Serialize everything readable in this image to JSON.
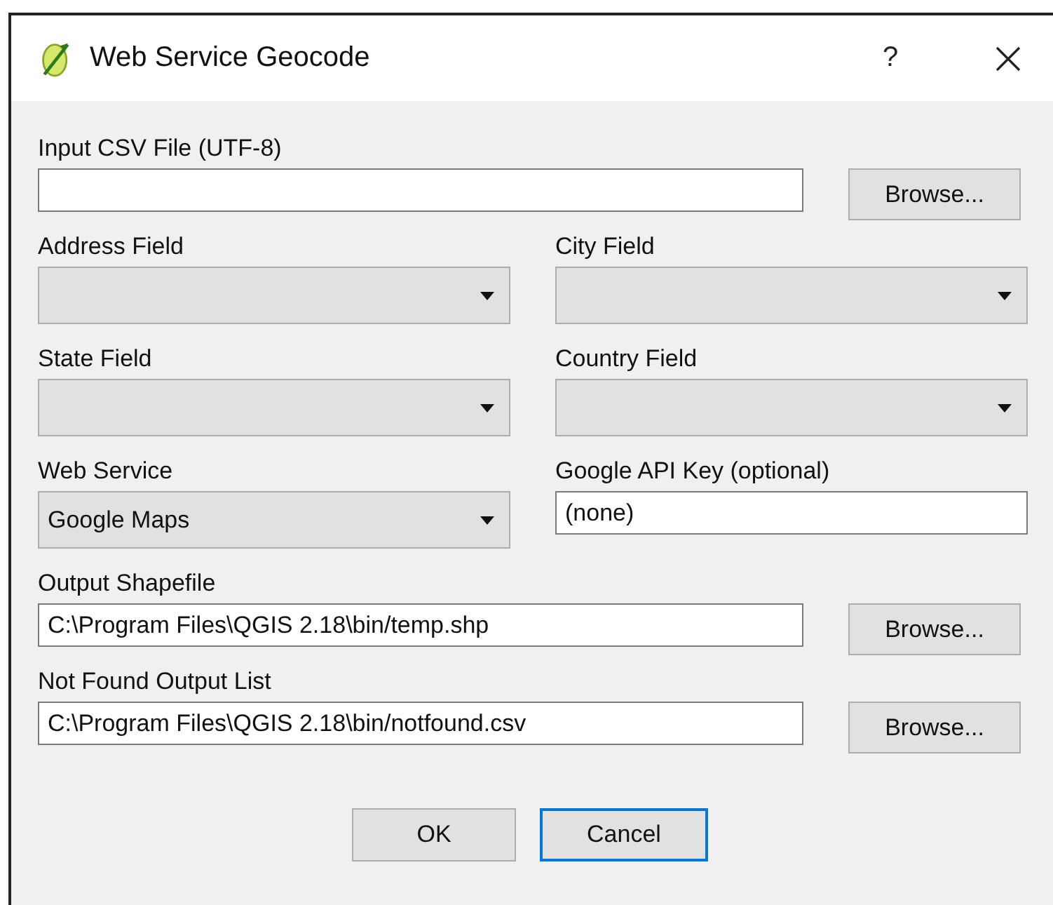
{
  "window": {
    "title": "Web Service Geocode",
    "help": "?"
  },
  "rows": [
    {
      "kind": "file",
      "label": "Input CSV File (UTF-8)",
      "button": "Browse..."
    },
    {
      "kind": "pair",
      "items": [
        {
          "kind": "combo",
          "label": "Address Field"
        },
        {
          "kind": "combo",
          "label": "City Field"
        }
      ]
    },
    {
      "kind": "pair",
      "items": [
        {
          "kind": "combo",
          "label": "State Field"
        },
        {
          "kind": "combo",
          "label": "Country Field"
        }
      ]
    },
    {
      "kind": "pair",
      "items": [
        {
          "kind": "combo",
          "label": "Web Service",
          "value": "Google Maps"
        },
        {
          "kind": "text",
          "label": "Google API Key (optional)",
          "value": "(none)"
        }
      ]
    },
    {
      "kind": "file",
      "label": "Output Shapefile",
      "value": "C:\\Program Files\\QGIS 2.18\\bin/temp.shp",
      "button": "Browse..."
    },
    {
      "kind": "file",
      "label": "Not Found Output List",
      "value": "C:\\Program Files\\QGIS 2.18\\bin/notfound.csv",
      "button": "Browse..."
    }
  ],
  "buttons": [
    {
      "label": "OK",
      "focused": false
    },
    {
      "label": "Cancel",
      "focused": true
    }
  ]
}
